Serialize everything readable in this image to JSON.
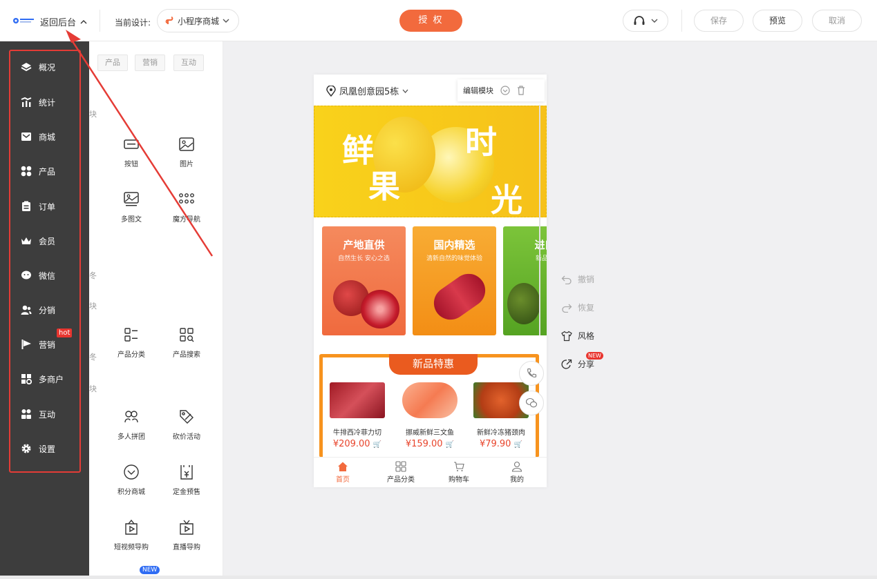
{
  "header": {
    "back_label": "返回后台",
    "current_design_label": "当前设计:",
    "design_name": "小程序商城",
    "authorize_label": "授 权",
    "save_label": "保存",
    "preview_label": "预览",
    "cancel_label": "取消"
  },
  "sidebar": {
    "items": [
      {
        "label": "概况",
        "icon": "layers-icon"
      },
      {
        "label": "统计",
        "icon": "stats-icon"
      },
      {
        "label": "商城",
        "icon": "mail-icon"
      },
      {
        "label": "产品",
        "icon": "grid-icon"
      },
      {
        "label": "订单",
        "icon": "clipboard-icon"
      },
      {
        "label": "会员",
        "icon": "crown-icon"
      },
      {
        "label": "微信",
        "icon": "wechat-icon"
      },
      {
        "label": "分销",
        "icon": "users-icon"
      },
      {
        "label": "营销",
        "icon": "flag-icon"
      },
      {
        "label": "多商户",
        "icon": "store-icon"
      },
      {
        "label": "互动",
        "icon": "interact-icon"
      },
      {
        "label": "设置",
        "icon": "gear-icon"
      }
    ],
    "hot_badge": "hot"
  },
  "panel": {
    "tabs": [
      "产品",
      "营销",
      "互动"
    ],
    "fragments": [
      "块",
      "冬",
      "块",
      "冬",
      "块"
    ],
    "components": [
      {
        "label": "按钮",
        "icon": "button-icon"
      },
      {
        "label": "图片",
        "icon": "image-icon"
      },
      {
        "label": "多图文",
        "icon": "multi-image-icon"
      },
      {
        "label": "魔方导航",
        "icon": "cube-nav-icon"
      },
      {
        "label": "产品分类",
        "icon": "category-icon"
      },
      {
        "label": "产品搜索",
        "icon": "product-search-icon"
      },
      {
        "label": "多人拼团",
        "icon": "group-buy-icon"
      },
      {
        "label": "砍价活动",
        "icon": "bargain-icon"
      },
      {
        "label": "积分商城",
        "icon": "points-mall-icon"
      },
      {
        "label": "定金预售",
        "icon": "presale-icon"
      },
      {
        "label": "短视频导购",
        "icon": "short-video-icon"
      },
      {
        "label": "直播导购",
        "icon": "live-icon"
      }
    ],
    "new_tag": "NEW"
  },
  "phone": {
    "location": "凤凰创意园5栋",
    "edit_module": "编辑模块",
    "banner_chars": [
      "鲜",
      "果",
      "时",
      "光"
    ],
    "cards": [
      {
        "title": "产地直供",
        "subtitle": "自然生长 安心之选",
        "color": "#f47b4b"
      },
      {
        "title": "国内精选",
        "subtitle": "清新自然的味觉体验",
        "color": "#f6a020"
      },
      {
        "title": "进口",
        "subtitle": "新品上",
        "color": "#6cb52c"
      }
    ],
    "promo_title": "新品特惠",
    "products": [
      {
        "name": "牛排西冷菲力切",
        "price": "¥209.00"
      },
      {
        "name": "挪威新鲜三文鱼",
        "price": "¥159.00"
      },
      {
        "name": "新鲜冷冻猪颈肉",
        "price": "¥79.90"
      }
    ],
    "tabs": [
      {
        "label": "首页",
        "icon": "home-icon"
      },
      {
        "label": "产品分类",
        "icon": "category-icon"
      },
      {
        "label": "购物车",
        "icon": "cart-icon"
      },
      {
        "label": "我的",
        "icon": "user-icon"
      }
    ]
  },
  "tools": {
    "undo": "撤销",
    "redo": "恢复",
    "style": "风格",
    "share": "分享",
    "new_badge": "NEW"
  },
  "colors": {
    "accent": "#f26a3d",
    "sidebar_bg": "#3d3d3d",
    "highlight": "#e53c36"
  }
}
